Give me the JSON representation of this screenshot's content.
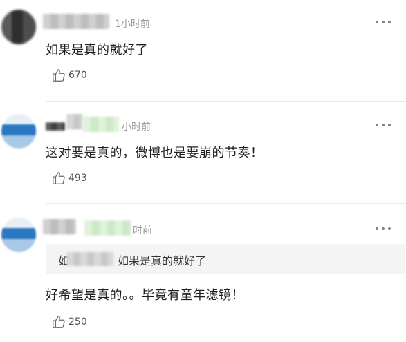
{
  "comments": [
    {
      "time": "1小时前",
      "text": "如果是真的就好了",
      "likes": "670"
    },
    {
      "time": "小时前",
      "text": "这对要是真的，微博也是要崩的节奏！",
      "likes": "493"
    },
    {
      "time": "时前",
      "quote_prefix": "如",
      "quote_text": "如果是真的就好了",
      "text": "好希望是真的。。毕竟有童年滤镜！",
      "likes": "250"
    }
  ],
  "icons": {
    "like": "thumbs-up-icon",
    "more": "more-dots-icon"
  },
  "colors": {
    "text": "#1e1e1e",
    "muted": "#9a9a9a",
    "quote_bg": "#f4f4f4"
  }
}
